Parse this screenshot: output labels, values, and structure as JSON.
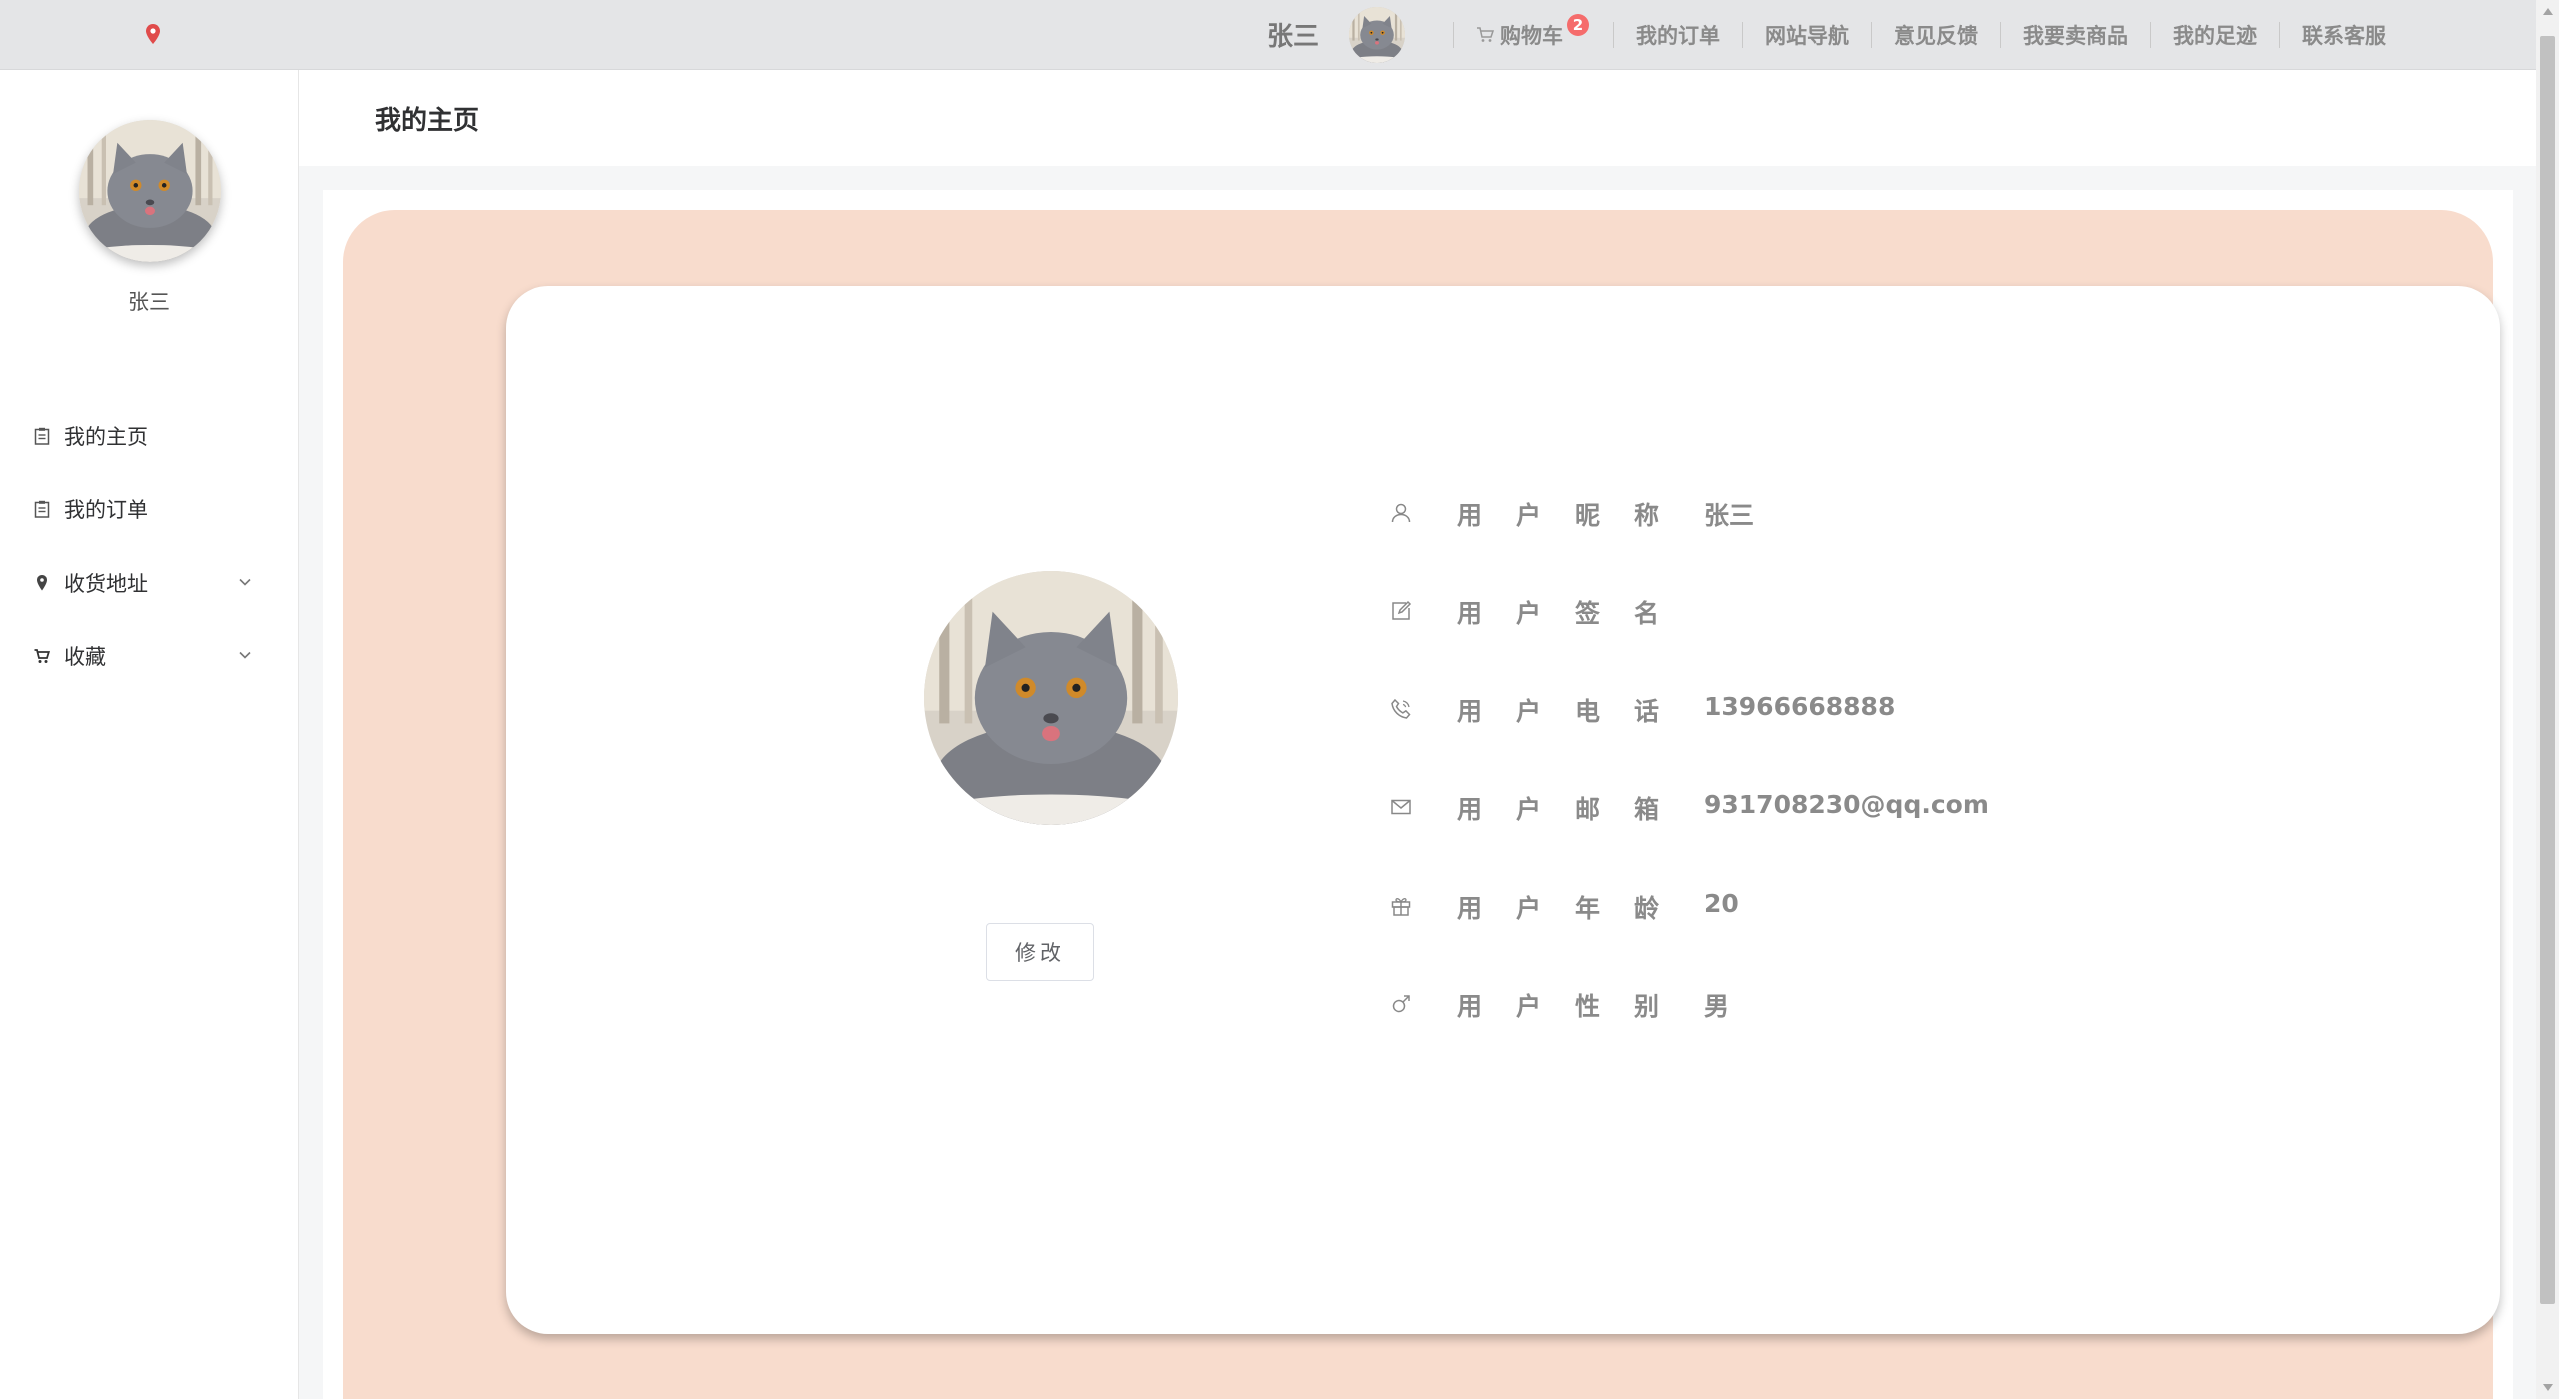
{
  "topbar": {
    "user_name": "张三",
    "cart_label": "购物车",
    "cart_count": "2",
    "links": [
      "我的订单",
      "网站导航",
      "意见反馈",
      "我要卖商品",
      "我的足迹",
      "联系客服"
    ]
  },
  "sidebar": {
    "user_name": "张三",
    "items": [
      {
        "label": "我的主页",
        "icon": "clipboard-icon"
      },
      {
        "label": "我的订单",
        "icon": "clipboard-icon"
      },
      {
        "label": "收货地址",
        "icon": "location-icon",
        "expandable": true
      },
      {
        "label": "收藏",
        "icon": "cart-icon",
        "expandable": true
      }
    ]
  },
  "page": {
    "title": "我的主页",
    "edit_button": "修改"
  },
  "profile": {
    "fields": [
      {
        "label": "用户昵称",
        "value": "张三",
        "icon": "user-icon"
      },
      {
        "label": "用户签名",
        "value": "",
        "icon": "edit-icon"
      },
      {
        "label": "用户电话",
        "value": "13966668888",
        "icon": "phone-icon"
      },
      {
        "label": "用户邮箱",
        "value": "931708230@qq.com",
        "icon": "mail-icon"
      },
      {
        "label": "用户年龄",
        "value": "20",
        "icon": "gift-icon"
      },
      {
        "label": "用户性别",
        "value": "男",
        "icon": "male-icon"
      }
    ]
  },
  "colors": {
    "peach": "#f8dccd",
    "badge": "#f56c6c",
    "location_pin": "#e04b4b"
  }
}
